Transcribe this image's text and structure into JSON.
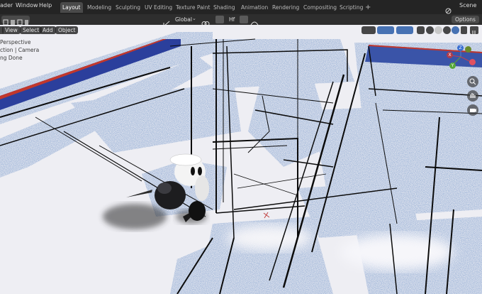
{
  "menubar": {
    "items": [
      "ader",
      "Window",
      "Help"
    ],
    "tabs": [
      "Layout",
      "Modeling",
      "Sculpting",
      "UV Editing",
      "Texture Paint",
      "Shading",
      "Animation",
      "Rendering",
      "Compositing",
      "Scripting"
    ],
    "active_tab": "Layout",
    "add_tab_label": "+",
    "scene_label": "Scene"
  },
  "toolbar": {
    "transform_orientation": "Global",
    "pivot_label": "Hf",
    "options_label": "Options"
  },
  "viewport_header": {
    "menus": [
      "View",
      "Select",
      "Add",
      "Object"
    ]
  },
  "overlay_info": {
    "line1": "Perspective",
    "line2": "ction | Camera",
    "line3": "ng Done"
  },
  "gizmo": {
    "z_label": "Z",
    "y_label": "Y",
    "x_label": "X"
  },
  "colors": {
    "topbar": "#242424",
    "accent": "#4772b3",
    "noise_blue": "#2a4a8a"
  }
}
